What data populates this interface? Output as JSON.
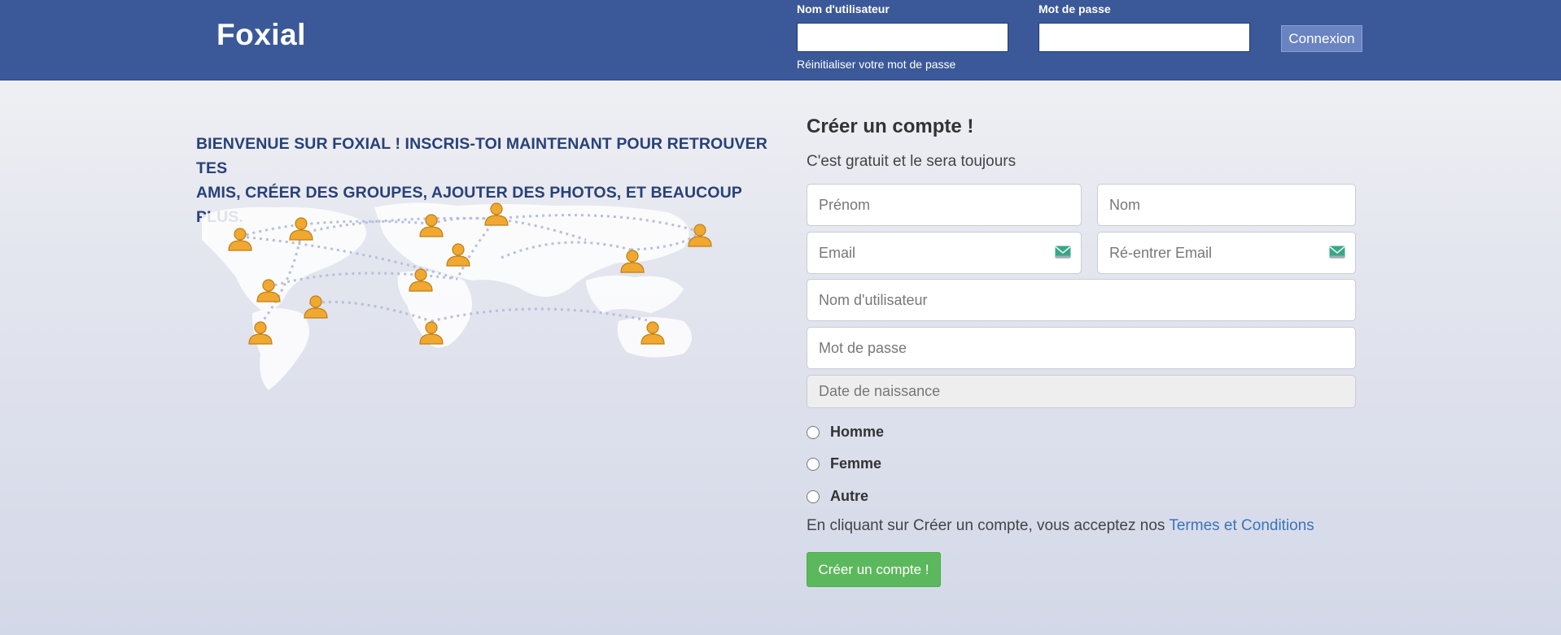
{
  "header": {
    "brand": "Foxial",
    "username_label": "Nom d'utilisateur",
    "password_label": "Mot de passe",
    "username_value": "",
    "password_value": "",
    "reset_link": "Réinitialiser votre mot de passe",
    "login_button": "Connexion"
  },
  "welcome": {
    "line1": "BIENVENUE SUR FOXIAL ! INSCRIS-TOI MAINTENANT POUR RETROUVER TES",
    "line2": "AMIS, CRÉER DES GROUPES, AJOUTER DES PHOTOS, ET BEAUCOUP PLUS."
  },
  "register": {
    "title": "Créer un compte !",
    "subtitle": "C'est gratuit et le sera toujours",
    "fields": {
      "firstname": "Prénom",
      "lastname": "Nom",
      "email": "Email",
      "email_confirm": "Ré-entrer Email",
      "username": "Nom d'utilisateur",
      "password": "Mot de passe",
      "birthdate": "Date de naissance"
    },
    "genders": [
      "Homme",
      "Femme",
      "Autre"
    ],
    "terms_text": "En cliquant sur Créer un compte, vous acceptez nos ",
    "terms_link": "Termes et Conditions",
    "submit": "Créer un compte !"
  },
  "colors": {
    "header_bg": "#3b5998",
    "submit_bg": "#5cb85c",
    "link": "#3b74b9",
    "welcome_text": "#284178",
    "person_icon": "#f0a830"
  },
  "icons": {
    "email": "mail-icon",
    "map": "world-map-people-icon"
  }
}
